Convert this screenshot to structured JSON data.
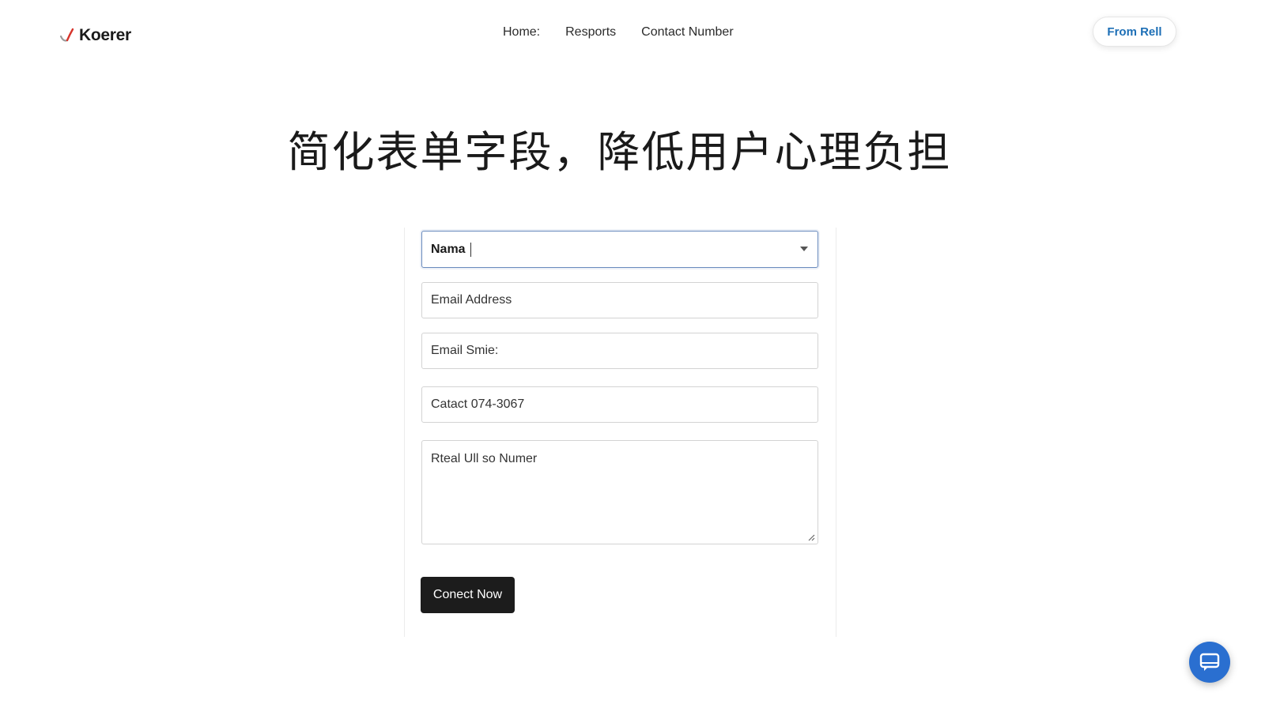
{
  "header": {
    "logo_text": "Koerer",
    "nav": [
      "Home:",
      "Resports",
      "Contact Number"
    ],
    "cta_label": "From Rell"
  },
  "hero": {
    "title": "简化表单字段，降低用户心理负担"
  },
  "form": {
    "name_value": "Nama",
    "email_placeholder": "Email Address",
    "email_smie_placeholder": "Email Smie:",
    "contact_value": "Catact 074-3067",
    "textarea_placeholder": "Rteal Ull so Numer",
    "submit_label": "Conect Now"
  },
  "colors": {
    "accent_blue": "#1d6fb6",
    "fab_blue": "#2a6fd0",
    "button_dark": "#1c1c1c",
    "logo_red": "#d6342b"
  },
  "icons": {
    "logo": "checkmark-logo-icon",
    "select": "chevron-down-icon",
    "fab": "chat-icon"
  }
}
